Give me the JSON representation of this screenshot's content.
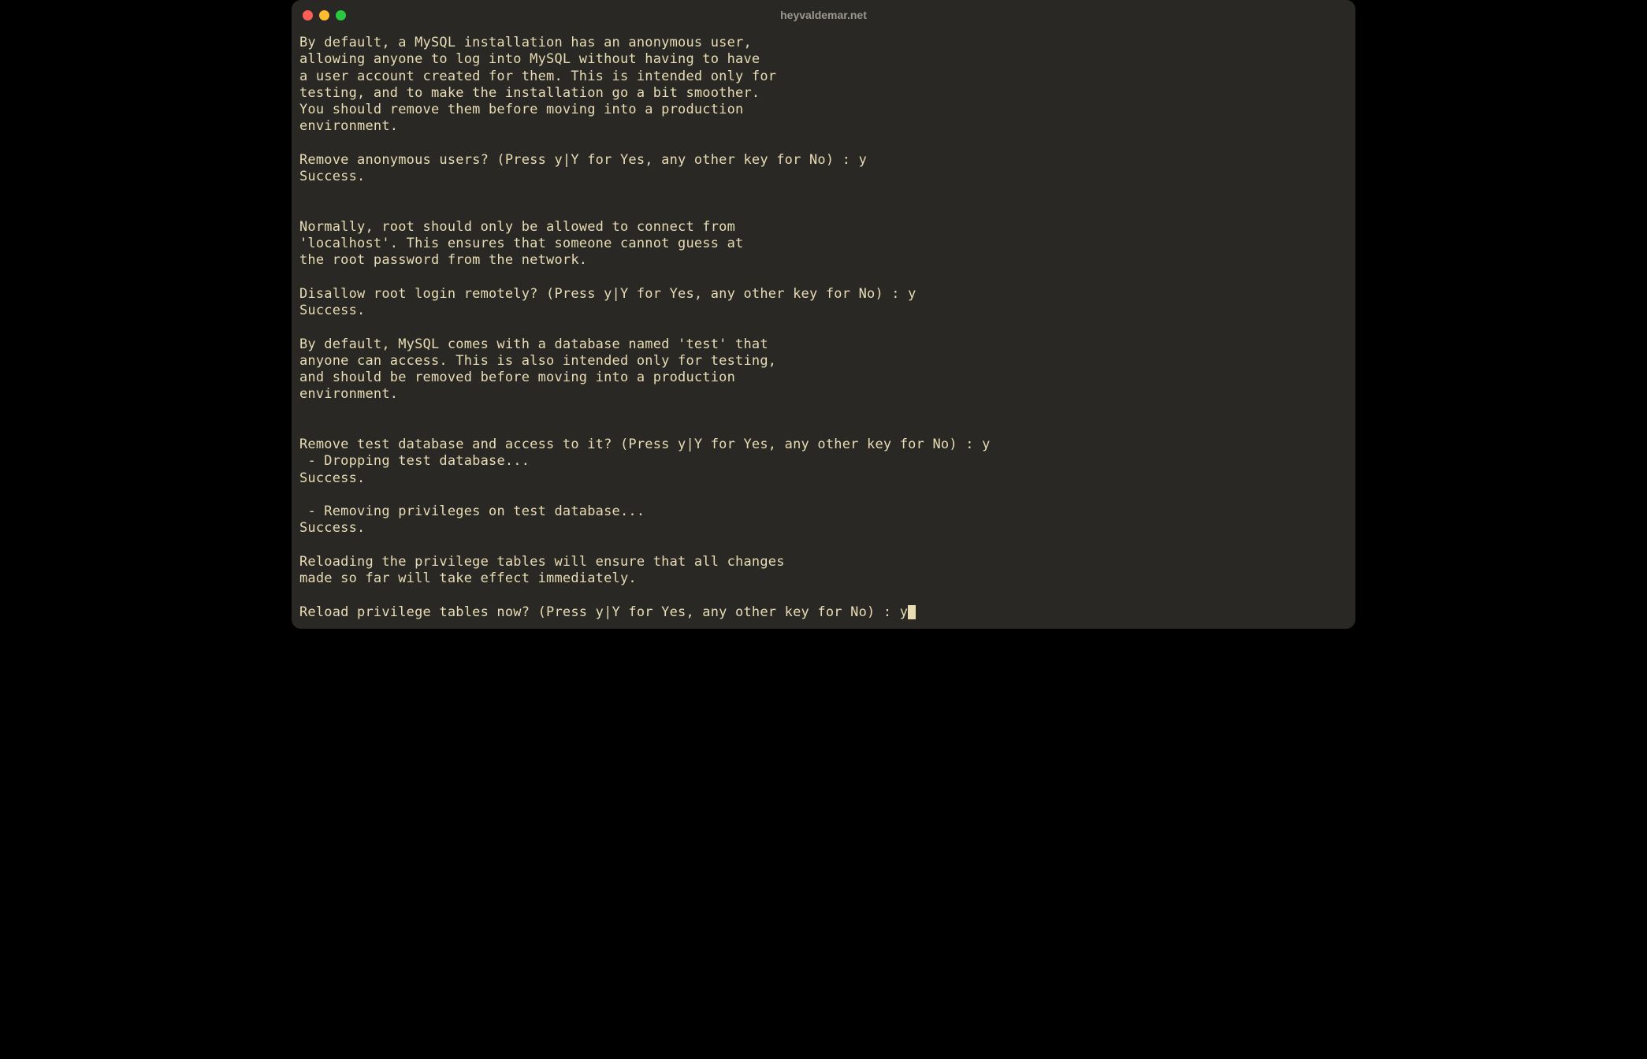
{
  "window": {
    "title": "heyvaldemar.net"
  },
  "terminal": {
    "lines": [
      "By default, a MySQL installation has an anonymous user,",
      "allowing anyone to log into MySQL without having to have",
      "a user account created for them. This is intended only for",
      "testing, and to make the installation go a bit smoother.",
      "You should remove them before moving into a production",
      "environment.",
      "",
      "Remove anonymous users? (Press y|Y for Yes, any other key for No) : y",
      "Success.",
      "",
      "",
      "Normally, root should only be allowed to connect from",
      "'localhost'. This ensures that someone cannot guess at",
      "the root password from the network.",
      "",
      "Disallow root login remotely? (Press y|Y for Yes, any other key for No) : y",
      "Success.",
      "",
      "By default, MySQL comes with a database named 'test' that",
      "anyone can access. This is also intended only for testing,",
      "and should be removed before moving into a production",
      "environment.",
      "",
      "",
      "Remove test database and access to it? (Press y|Y for Yes, any other key for No) : y",
      " - Dropping test database...",
      "Success.",
      "",
      " - Removing privileges on test database...",
      "Success.",
      "",
      "Reloading the privilege tables will ensure that all changes",
      "made so far will take effect immediately.",
      "",
      "Reload privilege tables now? (Press y|Y for Yes, any other key for No) : y"
    ]
  }
}
